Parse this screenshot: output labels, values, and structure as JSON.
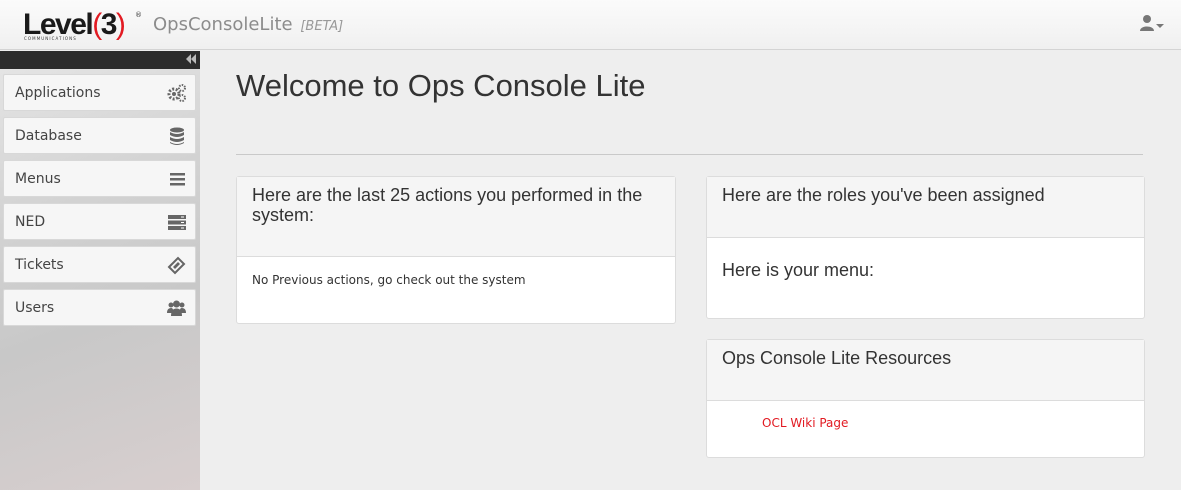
{
  "header": {
    "logo_text": "Level",
    "logo_number": "3",
    "logo_sub": "COMMUNICATIONS",
    "logo_reg": "®",
    "app_name": "OpsConsoleLite",
    "app_tag": "[BETA]",
    "user_icon": "user-icon"
  },
  "sidebar": {
    "collapse_icon": "double-chevron-left-icon",
    "items": [
      {
        "label": "Applications",
        "icon": "gears-icon"
      },
      {
        "label": "Database",
        "icon": "database-icon"
      },
      {
        "label": "Menus",
        "icon": "list-icon"
      },
      {
        "label": "NED",
        "icon": "server-icon"
      },
      {
        "label": "Tickets",
        "icon": "ticket-icon"
      },
      {
        "label": "Users",
        "icon": "users-icon"
      }
    ]
  },
  "main": {
    "title": "Welcome to Ops Console Lite",
    "actions_panel": {
      "heading": "Here are the last 25 actions you performed in the system:",
      "empty_text": "No Previous actions, go check out the system"
    },
    "roles_panel": {
      "heading": "Here are the roles you've been assigned",
      "menu_heading": "Here is your menu:"
    },
    "resources_panel": {
      "heading": "Ops Console Lite Resources",
      "link_label": "OCL Wiki Page"
    }
  },
  "colors": {
    "accent": "#e21a22",
    "sidebar_top": "#2c2c2c",
    "background": "#eeeeee"
  }
}
